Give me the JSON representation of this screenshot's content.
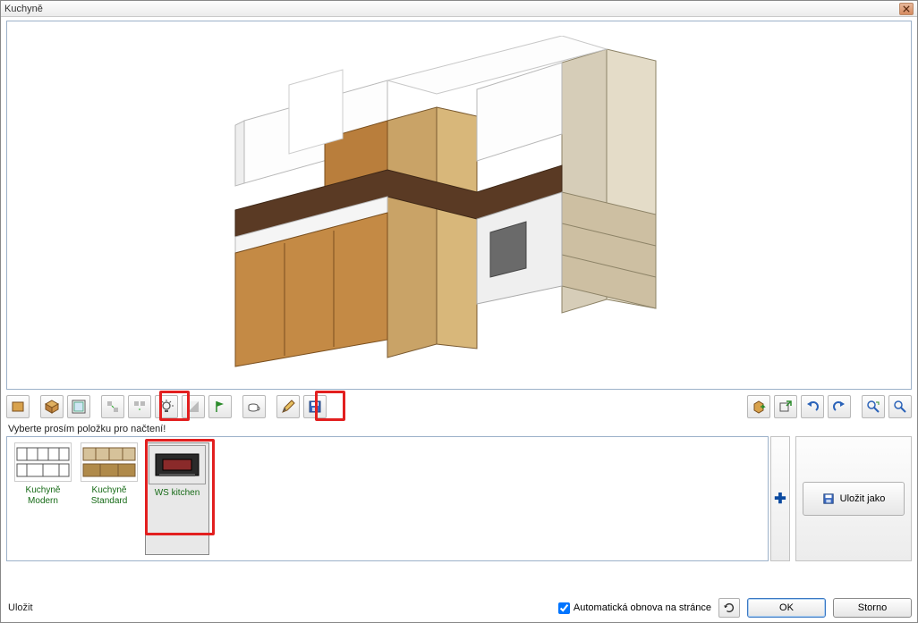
{
  "title": "Kuchyně",
  "select_prompt": "Vyberte prosím položku pro načtení!",
  "gallery": [
    {
      "label": "Kuchyně Modern"
    },
    {
      "label": "Kuchyně Standard"
    },
    {
      "label": "WS kitchen"
    }
  ],
  "saveas_label": "Uložit jako",
  "bottom": {
    "save_label": "Uložit",
    "auto_refresh": "Automatická obnova na stránce",
    "ok": "OK",
    "cancel": "Storno"
  }
}
